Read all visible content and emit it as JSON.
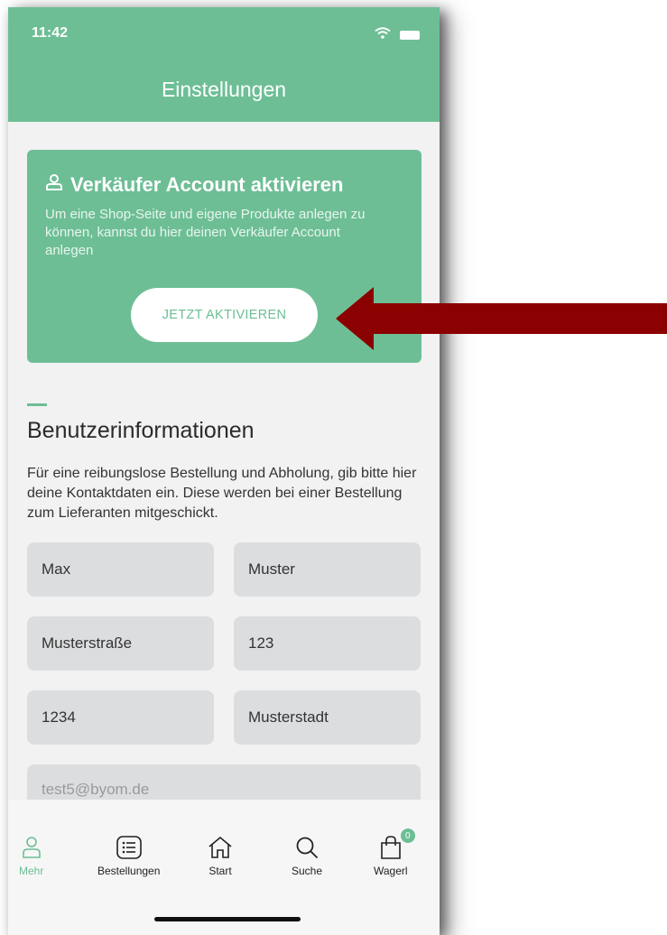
{
  "status": {
    "time": "11:42"
  },
  "header": {
    "title": "Einstellungen"
  },
  "seller_card": {
    "title": "Verkäufer Account aktivieren",
    "text": "Um eine Shop-Seite und eigene Produkte anlegen zu können, kannst du hier deinen Verkäufer Account anlegen",
    "button_label": "JETZT AKTIVIEREN"
  },
  "user_info": {
    "title": "Benutzerinformationen",
    "description": "Für eine reibungslose Bestellung und Abholung, gib bitte hier deine Kontaktdaten ein. Diese werden bei einer Bestellung zum Lieferanten mitgeschickt.",
    "first_name": "Max",
    "last_name": "Muster",
    "street": "Musterstraße",
    "house_number": "123",
    "zip": "1234",
    "city": "Musterstadt",
    "email": "test5@byom.de"
  },
  "tabs": [
    {
      "label": "Mehr",
      "icon": "person-icon",
      "active": true
    },
    {
      "label": "Bestellungen",
      "icon": "list-icon",
      "active": false
    },
    {
      "label": "Start",
      "icon": "home-icon",
      "active": false
    },
    {
      "label": "Suche",
      "icon": "search-icon",
      "active": false
    },
    {
      "label": "Wagerl",
      "icon": "bag-icon",
      "active": false,
      "badge": "0"
    }
  ],
  "colors": {
    "accent": "#6dbe95",
    "arrow": "#8b0000",
    "field_bg": "#dcdddf"
  }
}
